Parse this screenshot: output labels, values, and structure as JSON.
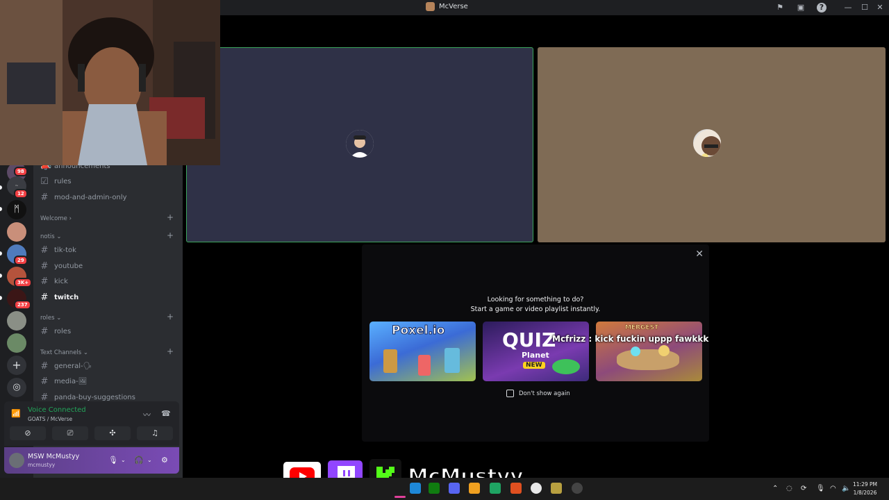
{
  "window": {
    "title": "McVerse"
  },
  "titlebar_icons": [
    "flag-icon",
    "inbox-icon",
    "help-icon"
  ],
  "window_controls": {
    "minimize": "—",
    "maximize": "☐",
    "close": "✕"
  },
  "servers": [
    {
      "badge": "98"
    },
    {
      "badge": "12"
    },
    {
      "badge": ""
    },
    {
      "badge": ""
    },
    {
      "badge": "29"
    },
    {
      "badge": "3K+"
    },
    {
      "badge": "237"
    },
    {
      "badge": ""
    },
    {
      "badge": ""
    }
  ],
  "channels": {
    "top": [
      {
        "label": "announcements",
        "icon": "megaphone-icon"
      },
      {
        "label": "rules",
        "icon": "rules-icon"
      },
      {
        "label": "mod-and-admin-only",
        "icon": "hash-icon"
      }
    ],
    "categories": {
      "welcome": "Welcome",
      "notis": "notis",
      "roles": "roles",
      "text": "Text Channels"
    },
    "notis": [
      "tik-tok",
      "youtube",
      "kick",
      "twitch"
    ],
    "roles": [
      "roles"
    ],
    "text": [
      "general-🗣",
      "media-🖼",
      "panda-buy-suggestions"
    ]
  },
  "voice": {
    "status": "Voice Connected",
    "location": "GOATS / McVerse"
  },
  "user": {
    "display_name": "MSW McMustyy",
    "handle": "mcmustyy"
  },
  "activity": {
    "title_line1": "Looking for something to do?",
    "title_line2": "Start a game or video playlist instantly.",
    "cards": [
      {
        "name": "Poxel.io"
      },
      {
        "name": "QUIZ Planet",
        "badge": "NEW"
      },
      {
        "name": "MERGEST"
      }
    ],
    "chat_overlay": "Mcfrizz : kick fuckin uppp fawkkk",
    "dont_show": "Don't show again"
  },
  "stream_overlay": {
    "handle": "McMustyy"
  },
  "taskbar": {
    "time": "11:29 PM",
    "date": "1/8/2026"
  },
  "colors": {
    "speaking_border": "#3ba55c",
    "tile_a_bg": "#2f3147",
    "tile_b_bg": "#7f6b55",
    "voice_green": "#23a55a",
    "user_panel": "#7a4bb5"
  }
}
